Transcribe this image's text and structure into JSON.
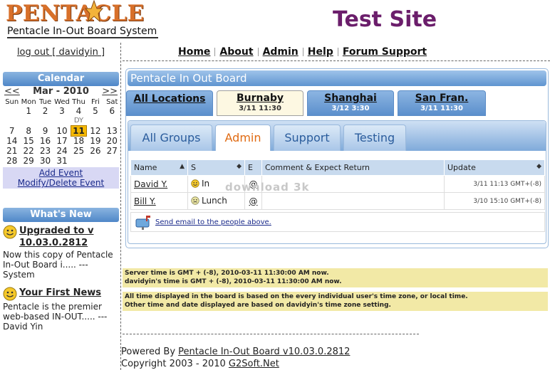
{
  "header": {
    "brand": "PENTACLE",
    "tagline": "Pentacle In-Out Board System",
    "site_title": "Test Site"
  },
  "user": {
    "logout_label": "log out [ davidyin ]"
  },
  "nav": {
    "items": [
      {
        "label": "Home"
      },
      {
        "label": "About"
      },
      {
        "label": "Admin"
      },
      {
        "label": "Help"
      },
      {
        "label": "Forum Support"
      }
    ]
  },
  "calendar": {
    "title": "Calendar",
    "prev": "<<",
    "next": ">>",
    "month_label": "Mar - 2010",
    "weekdays": [
      "Sun",
      "Mon",
      "Tue",
      "Wed",
      "Thu",
      "Fri",
      "Sat"
    ],
    "today": "11",
    "today_marker": "DY",
    "weeks": [
      [
        "",
        "1",
        "2",
        "3",
        "4",
        "5",
        "6"
      ],
      [
        "7",
        "8",
        "9",
        "10",
        "11",
        "12",
        "13"
      ],
      [
        "14",
        "15",
        "16",
        "17",
        "18",
        "19",
        "20"
      ],
      [
        "21",
        "22",
        "23",
        "24",
        "25",
        "26",
        "27"
      ],
      [
        "28",
        "29",
        "30",
        "31",
        "",
        "",
        ""
      ]
    ],
    "add_event": "Add Event",
    "modify_event": "Modify/Delete Event"
  },
  "news": {
    "title": "What's New",
    "items": [
      {
        "title": "Upgraded to v 10.03.0.2812",
        "body": "Now this copy of Pentacle In-Out Board i..... --- System"
      },
      {
        "title": "Your First News",
        "body": "Pentacle is the premier web-based IN-OUT..... --- David Yin"
      }
    ]
  },
  "board": {
    "title": "Pentacle In Out Board",
    "locations": [
      {
        "name": "All Locations",
        "time": ""
      },
      {
        "name": "Burnaby",
        "time": "3/11 11:30"
      },
      {
        "name": "Shanghai",
        "time": "3/12 3:30"
      },
      {
        "name": "San Fran.",
        "time": "3/11 11:30"
      }
    ],
    "active_location": "Burnaby",
    "groups": [
      "All Groups",
      "Admin",
      "Support",
      "Testing"
    ],
    "active_group": "Admin",
    "columns": {
      "name": "Name",
      "status": "S",
      "email": "E",
      "comment": "Comment & Expect Return",
      "update": "Update"
    },
    "rows": [
      {
        "name": "David Y.",
        "status": "In",
        "email": "@",
        "comment": "",
        "update": "3/11 11:13 GMT+(-8)"
      },
      {
        "name": "Bill Y.",
        "status": "Lunch",
        "email": "@",
        "comment": "",
        "update": "3/10 15:10 GMT+(-8)"
      }
    ],
    "send_email": "Send email to the people above.",
    "watermark": "download 3k"
  },
  "times": {
    "server": "Server time is GMT + (-8), 2010-03-11 11:30:00 AM now.",
    "user": "davidyin's time is GMT + (-8), 2010-03-11 11:30:00 AM now.",
    "note1": "All time displayed in the board is based on the every individual user's time zone, or local time.",
    "note2": "Other time and date displayed are based on davidyin's time zone setting."
  },
  "footer": {
    "powered_prefix": "Powered By",
    "product_link": "Pentacle In-Out Board v10.03.0.2812",
    "copyright_prefix": "Copyright 2003 - 2010",
    "company_link": "G2Soft.Net"
  },
  "colors": {
    "brand": "#d8702a",
    "site_title": "#6b1e6b",
    "panel_blue": "#5f95d0",
    "today_highlight": "#f5b800",
    "notice_bg": "#f2e9a6"
  }
}
